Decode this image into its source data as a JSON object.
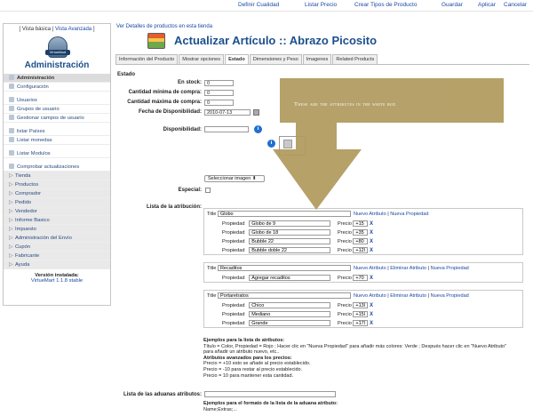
{
  "toolbar": {
    "items": [
      "Definir Cualidad",
      "Listar Precio",
      "Crear Tipos de Producto",
      "Guardar",
      "Aplicar",
      "Cancelar"
    ]
  },
  "sidebar": {
    "view_basic": "Vista básica",
    "view_separator": "|",
    "view_advanced": "Vista Avanzada",
    "views_prefix": "[",
    "views_suffix": "]",
    "logo_text": "VirtueMart",
    "title": "Administración",
    "items": [
      {
        "label": "Administración",
        "kind": "head"
      },
      {
        "label": "Configuración",
        "kind": "icon"
      },
      {
        "label": "",
        "kind": "gap"
      },
      {
        "label": "Usuarios",
        "kind": "icon"
      },
      {
        "label": "Grupos de usuario",
        "kind": "icon"
      },
      {
        "label": "Gestionar campos de usuario",
        "kind": "icon"
      },
      {
        "label": "",
        "kind": "gap"
      },
      {
        "label": "listar Países",
        "kind": "icon"
      },
      {
        "label": "Listar monedas",
        "kind": "icon"
      },
      {
        "label": "",
        "kind": "gap"
      },
      {
        "label": "Listar Modulos",
        "kind": "icon"
      },
      {
        "label": "",
        "kind": "gap"
      },
      {
        "label": "Comprobar actualizaciones",
        "kind": "icon"
      },
      {
        "label": "Tienda",
        "kind": "section"
      },
      {
        "label": "Productos",
        "kind": "section"
      },
      {
        "label": "Comprador",
        "kind": "section"
      },
      {
        "label": "Pedido",
        "kind": "section"
      },
      {
        "label": "Vendedor",
        "kind": "section"
      },
      {
        "label": "Informe Basico",
        "kind": "section"
      },
      {
        "label": "Impuesto",
        "kind": "section"
      },
      {
        "label": "Administración del Envío",
        "kind": "section"
      },
      {
        "label": "Cupón",
        "kind": "section"
      },
      {
        "label": "Fabricante",
        "kind": "section"
      },
      {
        "label": "Ayuda",
        "kind": "section"
      }
    ],
    "version_label": "Versión instalada:",
    "version_value": "VirtueMart 1.1.8 stable"
  },
  "breadcrumb": "Ver Detalles de productos en esta tienda",
  "page_title": "Actualizar Artículo :: Abrazo Picosito",
  "tabs": [
    {
      "label": "Información del Producto",
      "active": false
    },
    {
      "label": "Mostrar opciones",
      "active": false
    },
    {
      "label": "Estado",
      "active": true
    },
    {
      "label": "Dimensiones y Peso",
      "active": false
    },
    {
      "label": "Imagenes",
      "active": false
    },
    {
      "label": "Related Products",
      "active": false
    }
  ],
  "form": {
    "section_title": "Estado",
    "in_stock_label": "En stock:",
    "in_stock_value": "0",
    "min_purchase_label": "Cantidad mínima de compra:",
    "min_purchase_value": "0",
    "max_purchase_label": "Cantidad máxima de compra:",
    "max_purchase_value": "0",
    "availability_date_label": "Fecha de Disponibilidad:",
    "availability_date_value": "2010-07-13",
    "availability_label": "Disponibilidad:",
    "availability_value": "",
    "select_image_label": "Seleccionar imagen",
    "special_label": "Especial:",
    "attribute_list_label": "Lista de la atribución:",
    "customs_attributes_label": "Lista de las aduanas atributos:",
    "customs_attributes_value": ""
  },
  "attributes": [
    {
      "title_label": "Title",
      "title_value": "Globo",
      "links": [
        "Nuevo Atributo",
        "Nueva Propiedad"
      ],
      "properties": [
        {
          "label": "Propiedad",
          "value": "Globo de 9",
          "price_label": "Precio",
          "price": "+15",
          "remove": "X"
        },
        {
          "label": "Propiedad",
          "value": "Globo de 18",
          "price_label": "Precio",
          "price": "+35",
          "remove": "X"
        },
        {
          "label": "Propiedad",
          "value": "Bubble 22",
          "price_label": "Precio",
          "price": "+80",
          "remove": "X"
        },
        {
          "label": "Propiedad",
          "value": "Bubble doble 22",
          "price_label": "Precio",
          "price": "+120",
          "remove": "X"
        }
      ]
    },
    {
      "title_label": "Title",
      "title_value": "Recaditos",
      "links": [
        "Nuevo Atributo",
        "Eliminar Atributo",
        "Nueva Propiedad"
      ],
      "properties": [
        {
          "label": "Propiedad",
          "value": "Agregar recaditos",
          "price_label": "Precio",
          "price": "+70",
          "remove": "X"
        }
      ]
    },
    {
      "title_label": "Title",
      "title_value": "Portaretratos",
      "links": [
        "Nuevo Atributo",
        "Eliminar Atributo",
        "Nueva Propiedad"
      ],
      "properties": [
        {
          "label": "Propiedad",
          "value": "Chico",
          "price_label": "Precio",
          "price": "+130",
          "remove": "X"
        },
        {
          "label": "Propiedad",
          "value": "Mediano",
          "price_label": "Precio",
          "price": "+150",
          "remove": "X"
        },
        {
          "label": "Propiedad",
          "value": "Grande",
          "price_label": "Precio",
          "price": "+170",
          "remove": "X"
        }
      ]
    }
  ],
  "examples": {
    "heading": "Ejemplos para la lista de atributos:",
    "line1": "Título = Color, Propiedad = Rojo ; Hacer clic en \"Nueva Propiedad\" para añadir más colores: Verde ; Después hacer clic en \"Nuevo Atributo\"",
    "line2": "para añadir un atributo nuevo, etc..",
    "advanced_heading": "Atributos avanzados para los precios:",
    "adv1": "Precio = +10 esto se añade al precio establecido.",
    "adv2": "Precio = -10 para restar al precio establecido.",
    "adv3": "Precio = 10 para mantener esta cantidad.",
    "customs_heading": "Ejemplos para el formato de la lista de la aduana atributo:",
    "customs_example": "Name;Extras;..."
  },
  "annotation": {
    "text": "These are the attributes in the white box",
    "box_color": "#b09a5e"
  },
  "colors": {
    "link": "#1a49a5",
    "title": "#1c4f8c",
    "info_icon": "#1f6fd1"
  }
}
